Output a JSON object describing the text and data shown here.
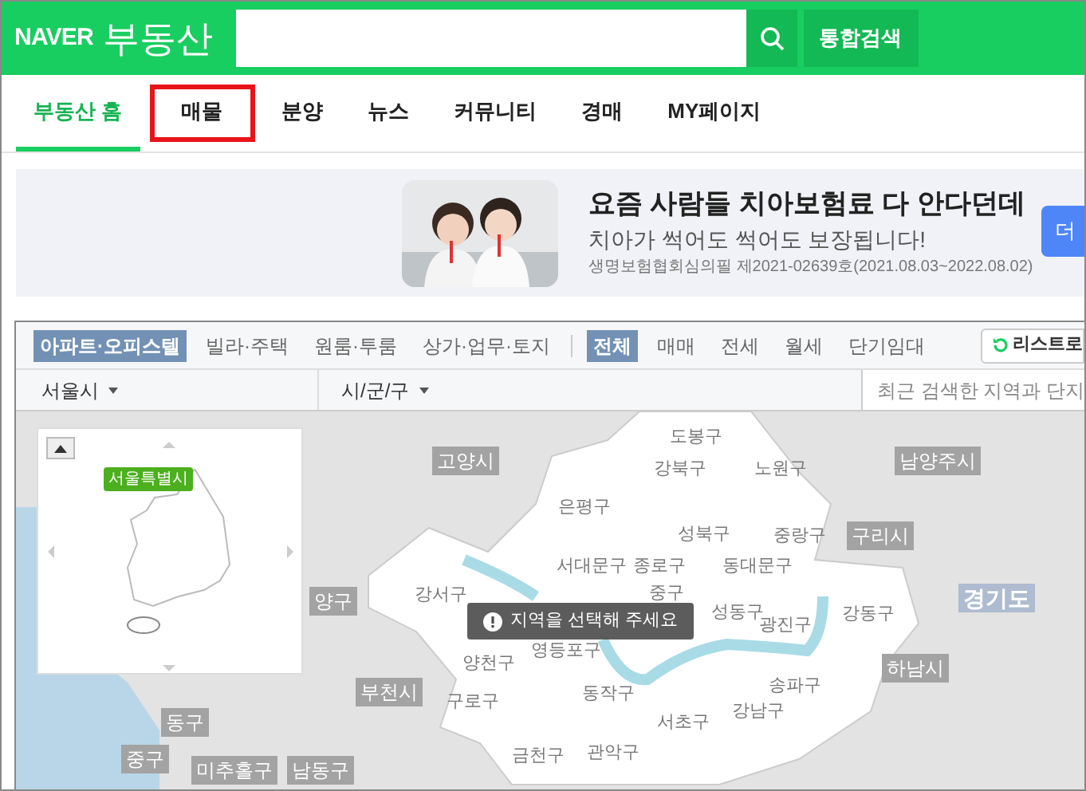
{
  "header": {
    "logo": "NAVER",
    "service": "부동산",
    "search_button": "통합검색"
  },
  "tabs": [
    {
      "label": "부동산 홈",
      "selected": true,
      "highlighted": false
    },
    {
      "label": "매물",
      "selected": false,
      "highlighted": true
    },
    {
      "label": "분양",
      "selected": false,
      "highlighted": false
    },
    {
      "label": "뉴스",
      "selected": false,
      "highlighted": false
    },
    {
      "label": "커뮤니티",
      "selected": false,
      "highlighted": false
    },
    {
      "label": "경매",
      "selected": false,
      "highlighted": false
    },
    {
      "label": "MY페이지",
      "selected": false,
      "highlighted": false
    }
  ],
  "ad": {
    "title": "요즘 사람들 치아보험료 다 안다던데",
    "subtitle": "치아가 썩어도 썩어도 보장됩니다!",
    "note": "생명보험협회심의필 제2021-02639호(2021.08.03~2022.08.02)",
    "button": "더"
  },
  "property_types": [
    {
      "label": "아파트·오피스텔",
      "selected": true
    },
    {
      "label": "빌라·주택",
      "selected": false
    },
    {
      "label": "원룸·투룸",
      "selected": false
    },
    {
      "label": "상가·업무·토지",
      "selected": false
    }
  ],
  "trade_types": [
    {
      "label": "전체",
      "selected": true
    },
    {
      "label": "매매",
      "selected": false
    },
    {
      "label": "전세",
      "selected": false
    },
    {
      "label": "월세",
      "selected": false
    },
    {
      "label": "단기임대",
      "selected": false
    }
  ],
  "list_button": "리스트로",
  "region_bar": {
    "city": "서울시",
    "district": "시/군/구",
    "search_placeholder": "최근 검색한 지역과 단지"
  },
  "minimap": {
    "label": "서울특별시"
  },
  "map": {
    "districts": [
      "도봉구",
      "강북구",
      "노원구",
      "은평구",
      "성북구",
      "중랑구",
      "서대문구",
      "종로구",
      "동대문구",
      "중구",
      "성동구",
      "광진구",
      "강동구",
      "강서구",
      "양천구",
      "영등포구",
      "구로구",
      "동작구",
      "송파구",
      "강남구",
      "서초구",
      "관악구",
      "금천구"
    ],
    "areas": [
      {
        "label": "고양시",
        "kind": "city"
      },
      {
        "label": "남양주시",
        "kind": "city"
      },
      {
        "label": "구리시",
        "kind": "city"
      },
      {
        "label": "경기도",
        "kind": "province"
      },
      {
        "label": "하남시",
        "kind": "city"
      },
      {
        "label": "양구",
        "kind": "city"
      },
      {
        "label": "부천시",
        "kind": "city"
      },
      {
        "label": "동구",
        "kind": "city"
      },
      {
        "label": "중구",
        "kind": "city"
      },
      {
        "label": "미추홀구",
        "kind": "city"
      },
      {
        "label": "남동구",
        "kind": "city"
      }
    ],
    "notice": "지역을 선택해 주세요"
  }
}
